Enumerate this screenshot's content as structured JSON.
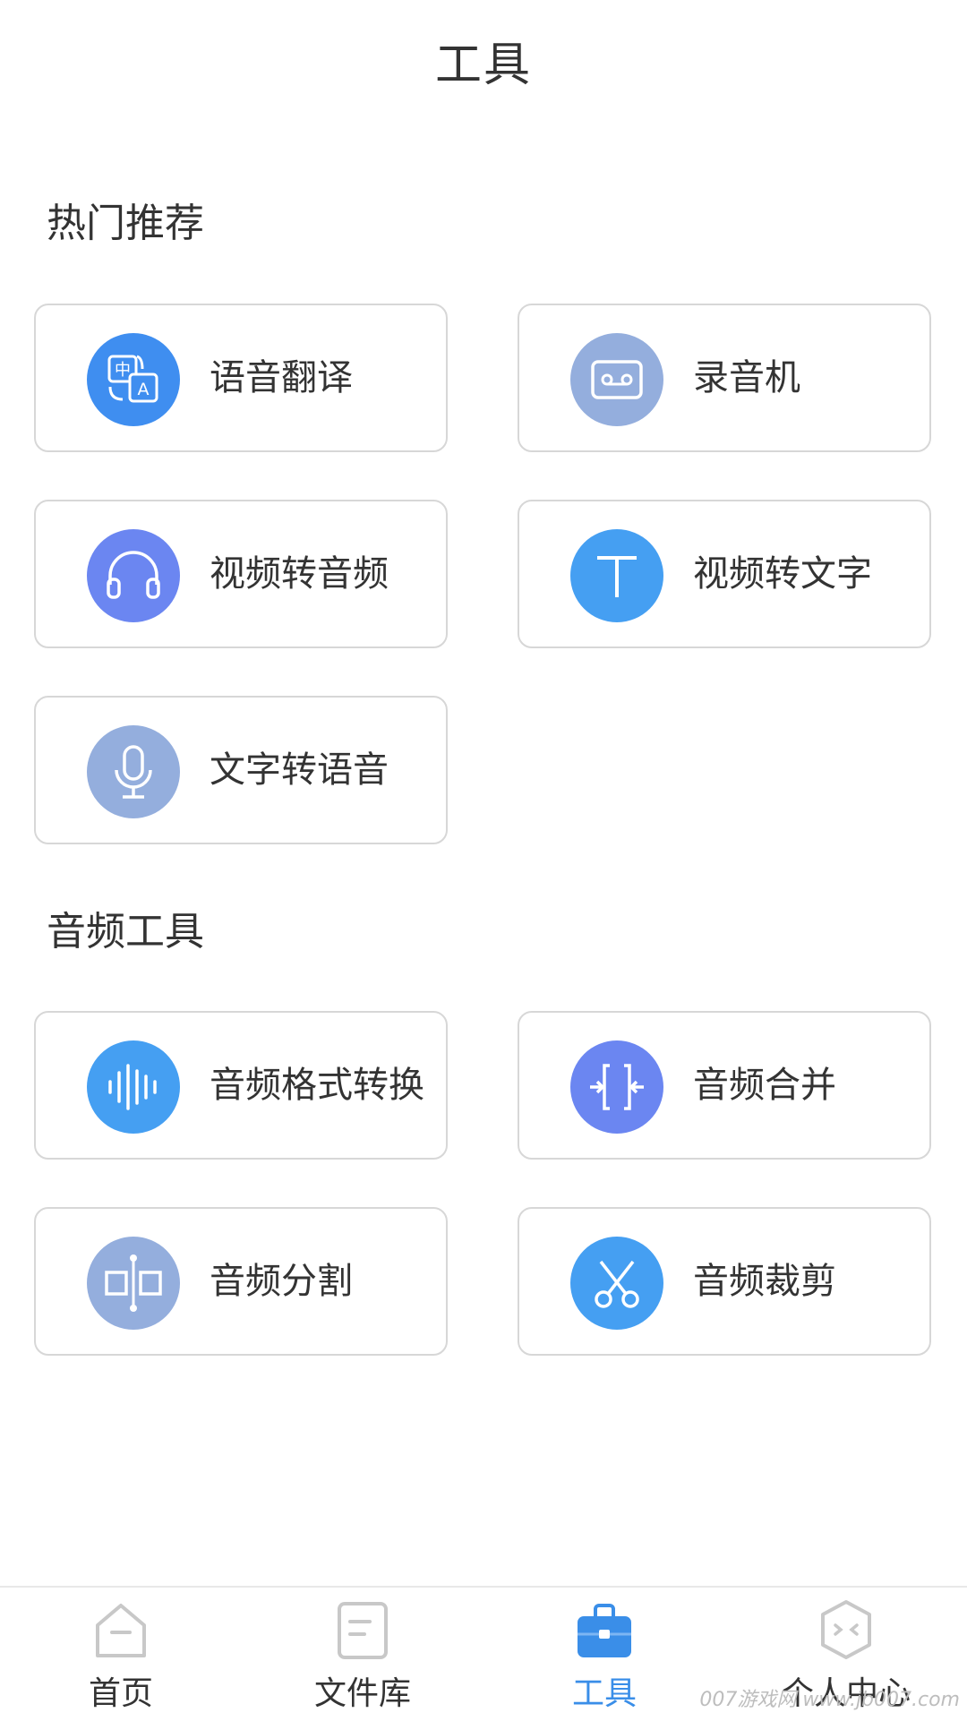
{
  "header": {
    "title": "工具"
  },
  "sections": [
    {
      "title": "热门推荐"
    },
    {
      "title": "音频工具"
    }
  ],
  "hot_tools": [
    {
      "label": "语音翻译",
      "icon": "translate-icon",
      "color": "#3f8ef0"
    },
    {
      "label": "录音机",
      "icon": "cassette-icon",
      "color": "#94aedd"
    },
    {
      "label": "视频转音频",
      "icon": "headphones-icon",
      "color": "#6b86f1"
    },
    {
      "label": "视频转文字",
      "icon": "text-t-icon",
      "color": "#459ff2"
    },
    {
      "label": "文字转语音",
      "icon": "microphone-icon",
      "color": "#94aedd"
    }
  ],
  "audio_tools": [
    {
      "label": "音频格式转换",
      "icon": "waveform-icon",
      "color": "#459ff2"
    },
    {
      "label": "音频合并",
      "icon": "merge-icon",
      "color": "#6b86f1"
    },
    {
      "label": "音频分割",
      "icon": "split-icon",
      "color": "#94aedd"
    },
    {
      "label": "音频裁剪",
      "icon": "scissors-icon",
      "color": "#459ff2"
    }
  ],
  "tabbar": {
    "items": [
      {
        "label": "首页",
        "icon": "home-icon",
        "active": false
      },
      {
        "label": "文件库",
        "icon": "document-icon",
        "active": false
      },
      {
        "label": "工具",
        "icon": "toolbox-icon",
        "active": true
      },
      {
        "label": "个人中心",
        "icon": "profile-hexagon-icon",
        "active": false
      }
    ],
    "active_color": "#3a8ee8",
    "inactive_color": "#c8c8c8"
  },
  "watermark": "007游戏网 www.jb007.com"
}
